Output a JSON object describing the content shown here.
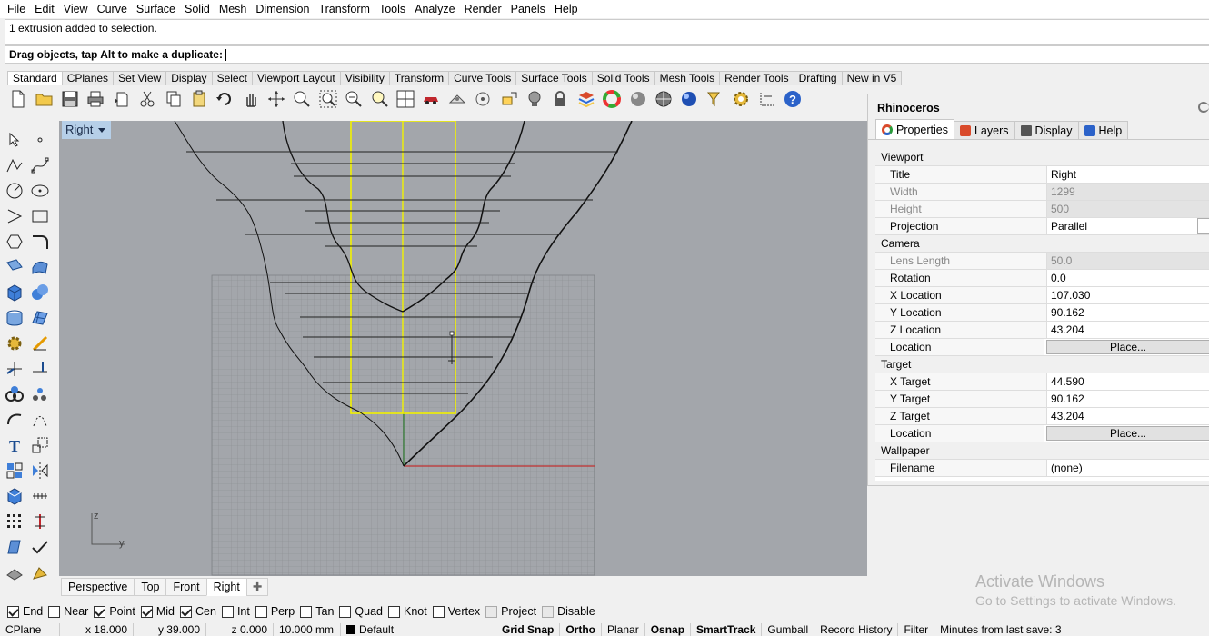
{
  "menu": [
    "File",
    "Edit",
    "View",
    "Curve",
    "Surface",
    "Solid",
    "Mesh",
    "Dimension",
    "Transform",
    "Tools",
    "Analyze",
    "Render",
    "Panels",
    "Help"
  ],
  "command": {
    "history": "1 extrusion added to selection.",
    "prompt": "Drag objects, tap Alt to make a duplicate:"
  },
  "toolbar_tabs": [
    "Standard",
    "CPlanes",
    "Set View",
    "Display",
    "Select",
    "Viewport Layout",
    "Visibility",
    "Transform",
    "Curve Tools",
    "Surface Tools",
    "Solid Tools",
    "Mesh Tools",
    "Render Tools",
    "Drafting",
    "New in V5"
  ],
  "toolbar_icons": [
    "new-file-icon",
    "open-file-icon",
    "save-icon",
    "print-icon",
    "import-icon",
    "cut-icon",
    "copy-icon",
    "paste-icon",
    "undo-icon",
    "pan-icon",
    "rotate-view-icon",
    "zoom-dynamic-icon",
    "zoom-window-icon",
    "zoom-extents-icon",
    "zoom-selected-icon",
    "viewport-layout-icon",
    "car-icon",
    "named-views-icon",
    "cplane-icon",
    "named-cplane-icon",
    "light-icon",
    "lock-icon",
    "layer-icon",
    "color-wheel-icon",
    "shade-icon",
    "rendered-icon",
    "render-icon",
    "filter-icon",
    "options-gear-icon",
    "dimension-icon",
    "help-icon"
  ],
  "viewport": {
    "name": "Right",
    "axis_z": "z",
    "axis_y": "y"
  },
  "viewport_tabs": [
    "Perspective",
    "Top",
    "Front",
    "Right"
  ],
  "osnap": [
    {
      "label": "End",
      "checked": true
    },
    {
      "label": "Near",
      "checked": false
    },
    {
      "label": "Point",
      "checked": true
    },
    {
      "label": "Mid",
      "checked": true
    },
    {
      "label": "Cen",
      "checked": true
    },
    {
      "label": "Int",
      "checked": false
    },
    {
      "label": "Perp",
      "checked": false
    },
    {
      "label": "Tan",
      "checked": false
    },
    {
      "label": "Quad",
      "checked": false
    },
    {
      "label": "Knot",
      "checked": false
    },
    {
      "label": "Vertex",
      "checked": false
    },
    {
      "label": "Project",
      "checked": false
    },
    {
      "label": "Disable",
      "checked": false
    }
  ],
  "status": {
    "cplane": "CPlane",
    "x": "x 18.000",
    "y": "y 39.000",
    "z": "z 0.000",
    "units": "10.000 mm",
    "layer": "Default",
    "grid_snap": "Grid Snap",
    "ortho": "Ortho",
    "planar": "Planar",
    "osnap": "Osnap",
    "smarttrack": "SmartTrack",
    "gumball": "Gumball",
    "record_history": "Record History",
    "filter": "Filter",
    "minutes": "Minutes from last save: 3"
  },
  "panel": {
    "title": "Rhinoceros",
    "tabs": [
      "Properties",
      "Layers",
      "Display",
      "Help"
    ],
    "viewport_section": "Viewport",
    "title_label": "Title",
    "title_value": "Right",
    "width_label": "Width",
    "width_value": "1299",
    "height_label": "Height",
    "height_value": "500",
    "projection_label": "Projection",
    "projection_value": "Parallel",
    "camera_section": "Camera",
    "lens_label": "Lens Length",
    "lens_value": "50.0",
    "rotation_label": "Rotation",
    "rotation_value": "0.0",
    "xloc_label": "X Location",
    "xloc_value": "107.030",
    "yloc_label": "Y Location",
    "yloc_value": "90.162",
    "zloc_label": "Z Location",
    "zloc_value": "43.204",
    "cam_location_label": "Location",
    "cam_place": "Place...",
    "target_section": "Target",
    "xtgt_label": "X Target",
    "xtgt_value": "44.590",
    "ytgt_label": "Y Target",
    "ytgt_value": "90.162",
    "ztgt_label": "Z Target",
    "ztgt_value": "43.204",
    "tgt_location_label": "Location",
    "tgt_place": "Place...",
    "wallpaper_section": "Wallpaper",
    "filename_label": "Filename",
    "filename_value": "(none)"
  },
  "watermark": {
    "line1": "Activate Windows",
    "line2": "Go to Settings to activate Windows."
  }
}
